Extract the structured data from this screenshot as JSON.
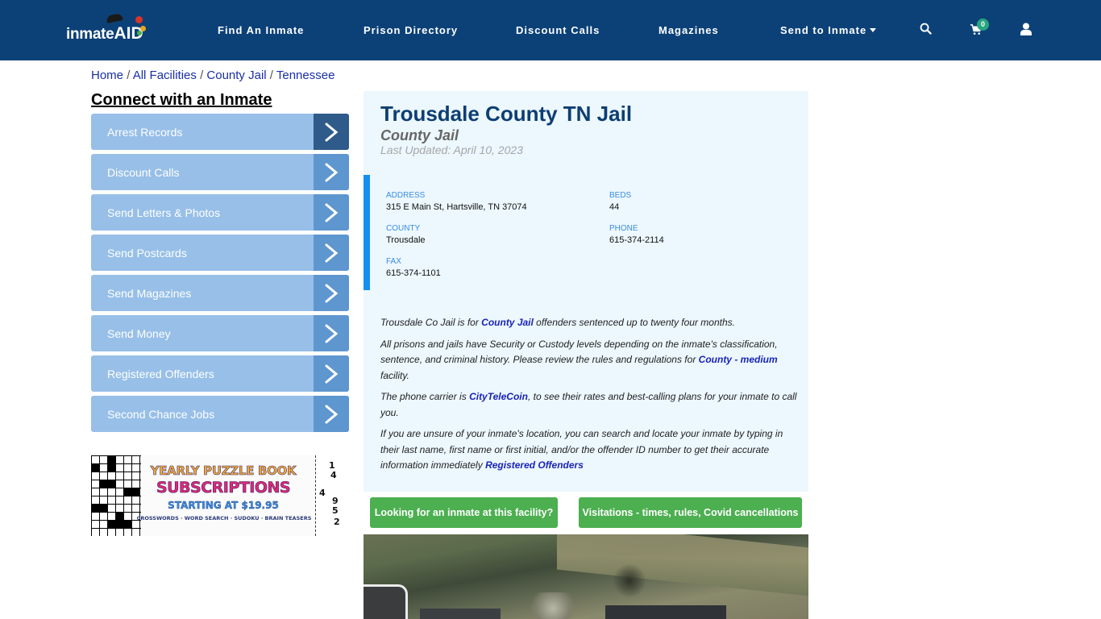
{
  "brand": {
    "logo_text": "inmate",
    "logo_accent": "AID"
  },
  "nav": {
    "links": [
      {
        "label": "Find An Inmate"
      },
      {
        "label": "Prison Directory"
      },
      {
        "label": "Discount Calls"
      },
      {
        "label": "Magazines"
      },
      {
        "label": "Send to Inmate"
      }
    ],
    "cart_count": "0",
    "icons": [
      "search-icon",
      "cart-icon",
      "user-icon"
    ]
  },
  "breadcrumb": [
    {
      "label": "Home"
    },
    {
      "label": "All Facilities"
    },
    {
      "label": "County Jail"
    },
    {
      "label": "Tennessee"
    }
  ],
  "breadcrumb_separator": "/",
  "sidebar": {
    "title": "Connect with an Inmate",
    "items": [
      {
        "label": "Arrest Records"
      },
      {
        "label": "Discount Calls"
      },
      {
        "label": "Send Letters & Photos"
      },
      {
        "label": "Send Postcards"
      },
      {
        "label": "Send Magazines"
      },
      {
        "label": "Send Money"
      },
      {
        "label": "Registered Offenders"
      },
      {
        "label": "Second Chance Jobs"
      }
    ]
  },
  "ad": {
    "line1": "YEARLY PUZZLE BOOK",
    "line2": "SUBSCRIPTIONS",
    "line3": "STARTING AT $19.95",
    "line4": "CROSSWORDS · WORD SEARCH · SUDOKU · BRAIN TEASERS",
    "sudoku_digits": [
      "1",
      "4",
      "4",
      "9",
      "5",
      "2"
    ]
  },
  "facility": {
    "title": "Trousdale County TN Jail",
    "type": "County Jail",
    "last_updated": "Last Updated: April 10, 2023",
    "info": {
      "address_label": "ADDRESS",
      "address": "315 E Main St, Hartsville, TN 37074",
      "beds_label": "BEDS",
      "beds": "44",
      "county_label": "COUNTY",
      "county": "Trousdale",
      "phone_label": "PHONE",
      "phone": "615-374-2114",
      "fax_label": "FAX",
      "fax": "615-374-1101"
    },
    "description": {
      "p1_before": "Trousdale Co Jail is for ",
      "p1_link": "County Jail",
      "p1_after": " offenders sentenced up to twenty four months.",
      "p2_before": "All prisons and jails have Security or Custody levels depending on the inmate's classification, sentence, and criminal history. Please review the rules and regulations for ",
      "p2_link": "County - medium",
      "p2_after": " facility.",
      "p3_before": "The phone carrier is ",
      "p3_link": "CityTeleCoin",
      "p3_after": ", to see their rates and best-calling plans for your inmate to call you.",
      "p4_before": "If you are unsure of your inmate's location, you can search and locate your inmate by typing in their last name, first name or first initial, and/or the offender ID number to get their accurate information immediately ",
      "p4_link": "Registered Offenders"
    }
  },
  "buttons": {
    "find_inmate": "Looking for an inmate at this facility?",
    "visitation": "Visitations - times, rules, Covid cancellations"
  },
  "colors": {
    "navbar": "#0c4178",
    "sidebar_item": "#97bfe8",
    "sidebar_arrow": "#5e96cf",
    "sidebar_arrow_active": "#2e5b8a",
    "panel_bg": "#ecf7fe",
    "info_accent": "#138ff0",
    "green_button": "#4caf50",
    "title": "#0d3e72",
    "link": "#1a24b5"
  }
}
